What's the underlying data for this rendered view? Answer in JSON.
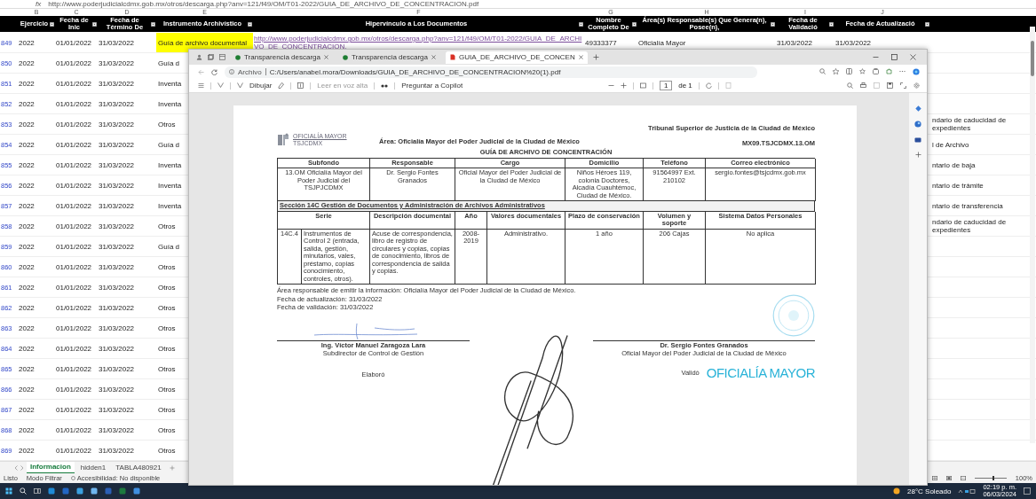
{
  "formula_bar": {
    "function_label": "fx",
    "formula": "http://www.poderjudicialcdmx.gob.mx/otros/descarga.php?anv=121/f49/OM/T01-2022/GUIA_DE_ARCHIVO_DE_CONCENTRACION.pdf"
  },
  "sheet": {
    "column_letters": [
      "B",
      "C",
      "D",
      "E",
      "F",
      "G",
      "H",
      "I",
      "J"
    ],
    "headers": [
      "Ejercicio",
      "Fecha de Inic",
      "Fecha de Término De",
      "Instrumento Archivístico",
      "Hipervínculo a Los Documentos",
      "Nombre Completo De",
      "Área(s) Responsable(s) Que Genera(n), Posee(n),",
      "Fecha de Validació",
      "Fecha de Actualizació"
    ],
    "rows": [
      {
        "row": "849",
        "highlighted": true,
        "cells": [
          "2022",
          "01/01/2022",
          "31/03/2022",
          "Guía de archivo documental",
          "http://www.poderjudicialcdmx.gob.mx/otros/descarga.php?anv=121/f49/OM/T01-2022/GUIA_DE_ARCHIVO_DE_CONCENTRACION.",
          "49333377",
          "Oficialía Mayor",
          "31/03/2022",
          "31/03/2022"
        ]
      },
      {
        "row": "850",
        "highlighted": false,
        "cells": [
          "2022",
          "01/01/2022",
          "31/03/2022",
          "Guía d"
        ]
      },
      {
        "row": "851",
        "highlighted": false,
        "cells": [
          "2022",
          "01/01/2022",
          "31/03/2022",
          "Inventa"
        ]
      },
      {
        "row": "852",
        "highlighted": false,
        "cells": [
          "2022",
          "01/01/2022",
          "31/03/2022",
          "Inventa"
        ]
      },
      {
        "row": "853",
        "highlighted": false,
        "cells": [
          "2022",
          "01/01/2022",
          "31/03/2022",
          "Otros"
        ],
        "tail": "ndario de caducidad de expedientes"
      },
      {
        "row": "854",
        "highlighted": false,
        "cells": [
          "2022",
          "01/01/2022",
          "31/03/2022",
          "Guía d"
        ],
        "tail": "l de Archivo"
      },
      {
        "row": "855",
        "highlighted": false,
        "cells": [
          "2022",
          "01/01/2022",
          "31/03/2022",
          "Inventa"
        ],
        "tail": "ntario de baja"
      },
      {
        "row": "856",
        "highlighted": false,
        "cells": [
          "2022",
          "01/01/2022",
          "31/03/2022",
          "Inventa"
        ],
        "tail": "ntario de trámite"
      },
      {
        "row": "857",
        "highlighted": false,
        "cells": [
          "2022",
          "01/01/2022",
          "31/03/2022",
          "Inventa"
        ],
        "tail": "ntario de transferencia"
      },
      {
        "row": "858",
        "highlighted": false,
        "cells": [
          "2022",
          "01/01/2022",
          "31/03/2022",
          "Otros"
        ],
        "tail": "ndario de caducidad de expedientes"
      },
      {
        "row": "859",
        "highlighted": false,
        "cells": [
          "2022",
          "01/01/2022",
          "31/03/2022",
          "Guía d"
        ]
      },
      {
        "row": "860",
        "highlighted": false,
        "cells": [
          "2022",
          "01/01/2022",
          "31/03/2022",
          "Otros"
        ]
      },
      {
        "row": "861",
        "highlighted": false,
        "cells": [
          "2022",
          "01/01/2022",
          "31/03/2022",
          "Otros"
        ]
      },
      {
        "row": "862",
        "highlighted": false,
        "cells": [
          "2022",
          "01/01/2022",
          "31/03/2022",
          "Otros"
        ]
      },
      {
        "row": "863",
        "highlighted": false,
        "cells": [
          "2022",
          "01/01/2022",
          "31/03/2022",
          "Otros"
        ]
      },
      {
        "row": "864",
        "highlighted": false,
        "cells": [
          "2022",
          "01/01/2022",
          "31/03/2022",
          "Otros"
        ]
      },
      {
        "row": "865",
        "highlighted": false,
        "cells": [
          "2022",
          "01/01/2022",
          "31/03/2022",
          "Otros"
        ]
      },
      {
        "row": "866",
        "highlighted": false,
        "cells": [
          "2022",
          "01/01/2022",
          "31/03/2022",
          "Otros"
        ]
      },
      {
        "row": "867",
        "highlighted": false,
        "cells": [
          "2022",
          "01/01/2022",
          "31/03/2022",
          "Otros"
        ]
      },
      {
        "row": "868",
        "highlighted": false,
        "cells": [
          "2022",
          "01/01/2022",
          "31/03/2022",
          "Otros"
        ]
      },
      {
        "row": "869",
        "highlighted": false,
        "cells": [
          "2022",
          "01/01/2022",
          "31/03/2022",
          "Otros"
        ]
      }
    ]
  },
  "sheet_tabs": [
    {
      "label": "Informacion",
      "selected": true
    },
    {
      "label": "hidden1",
      "selected": false
    },
    {
      "label": "TABLA480921",
      "selected": false
    }
  ],
  "status_bar": {
    "mode": "Listo",
    "filter": "Modo Filtrar",
    "accessibility": "Accesibilidad: No disponible",
    "zoom_slider": {
      "level": 0.55
    },
    "zoom": "100%"
  },
  "browser": {
    "tabs": [
      {
        "label": "Transparencia descarga",
        "kind": "web",
        "selected": false
      },
      {
        "label": "Transparencia descarga",
        "kind": "web",
        "selected": false
      },
      {
        "label": "GUIA_DE_ARCHIVO_DE_CONCEN",
        "kind": "pdf",
        "selected": true
      }
    ],
    "address": {
      "scheme": "Archivo",
      "path": "C:/Users/anabel.mora/Downloads/GUIA_DE_ARCHIVO_DE_CONCENTRACION%20(1).pdf"
    },
    "toolbar": {
      "draw": "Dibujar",
      "read_aloud": "Leer en voz alta",
      "read_aloud_disabled": true,
      "copilot": "Preguntar a Copilot",
      "page": "1",
      "page_total": "de 1"
    }
  },
  "document": {
    "logo": {
      "name": "OFICIALÍA MAYOR",
      "sub": "TSJCDMX"
    },
    "area": "Área: Oficialía Mayor del Poder Judicial de la Ciudad de México",
    "institution": "Tribunal Superior de Justicia de la Ciudad de México",
    "code": "MX09.TSJCDMX.13.OM",
    "title": "GUÍA DE ARCHIVO DE CONCENTRACIÓN",
    "table1": {
      "columns": [
        "Subfondo",
        "Responsable",
        "Cargo",
        "Domicilio",
        "Teléfono",
        "Correo electrónico"
      ],
      "row": [
        "13.OM Oficialía Mayor del Poder Judicial del TSJPJCDMX",
        "Dr. Sergio Fontes Granados",
        "Oficial Mayor del Poder Judicial de la Ciudad de México",
        "Niños Héroes 119, colonia Doctores, Alcadía Cuauhtémoc, Ciudad de México.",
        "91564997 Ext. 210102",
        "sergio.fontes@tsjcdmx.gob.mx"
      ]
    },
    "section": "Sección 14C Gestión de Documentos y Administración de Archivos Administrativos",
    "table2": {
      "columns": [
        "Serie",
        "Descripción documental",
        "Año",
        "Valores documentales",
        "Plazo de conservación",
        "Volumen y soporte",
        "Sistema Datos Personales"
      ],
      "row": [
        "14C.4",
        "Instrumentos de Control 2 (entrada, salida, gestión, minutarios, vales, préstamo, copias conocimiento, controles, otros).",
        "Acuse de correspondencia, libro de registro de circulares y copias, copias de conocimiento, libros de correspondencia de salida y copias.",
        "2008-2019",
        "Administrativo.",
        "1 año",
        "206 Cajas",
        "No aplica"
      ]
    },
    "notes": [
      "Área responsable de emitir la información: Oficialía Mayor del Poder Judicial de la Ciudad de México.",
      "Fecha de actualización: 31/03/2022",
      "Fecha de validación: 31/03/2022"
    ],
    "signatures": [
      {
        "kind": "small",
        "name": "Ing. Víctor Manuel Zaragoza Lara",
        "position": "Subdirector de Control de Gestión",
        "role": "Elaboró"
      },
      {
        "kind": "large",
        "name": "Dr. Sergio Fontes Granados",
        "position": "Oficial Mayor del Poder Judicial de la Ciudad de México",
        "role": "Validó",
        "stamp": "OFICIALÍA MAYOR"
      }
    ]
  },
  "taskbar": {
    "weather": "28°C Soleado",
    "time": "02:19 p. m.",
    "date": "06/03/2024"
  }
}
